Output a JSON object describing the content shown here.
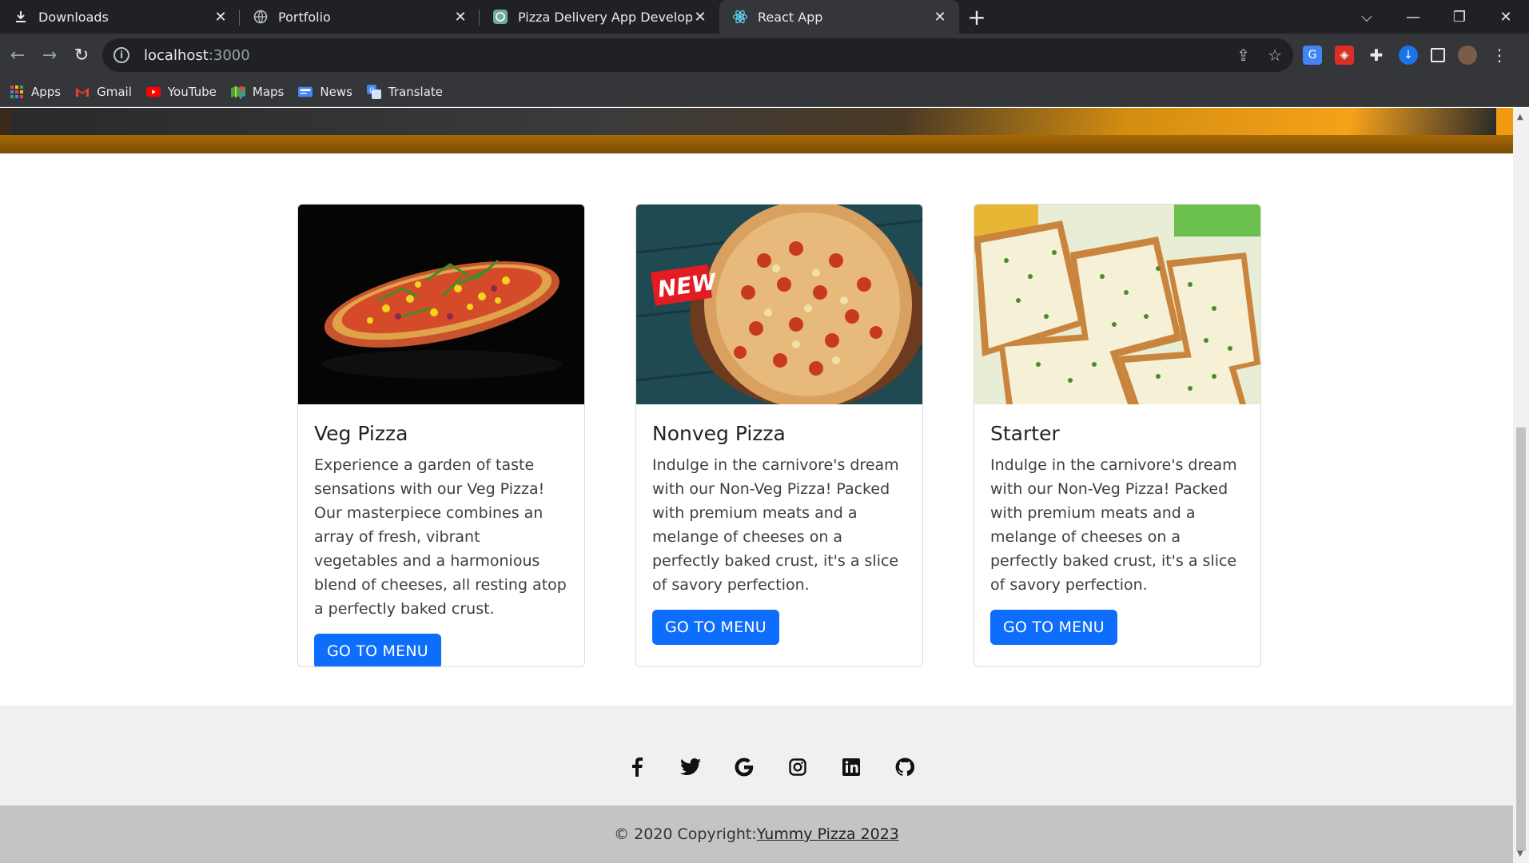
{
  "browser": {
    "tabs": [
      {
        "label": "Downloads",
        "icon": "download-icon"
      },
      {
        "label": "Portfolio",
        "icon": "globe-icon"
      },
      {
        "label": "Pizza Delivery App Development",
        "icon": "chatgpt-icon"
      },
      {
        "label": "React App",
        "icon": "react-icon",
        "active": true
      }
    ],
    "url_host": "localhost",
    "url_port": ":3000",
    "bookmarks": [
      {
        "label": "Apps",
        "icon": "apps-grid-icon"
      },
      {
        "label": "Gmail",
        "icon": "gmail-icon"
      },
      {
        "label": "YouTube",
        "icon": "youtube-icon"
      },
      {
        "label": "Maps",
        "icon": "maps-icon"
      },
      {
        "label": "News",
        "icon": "news-icon"
      },
      {
        "label": "Translate",
        "icon": "translate-icon"
      }
    ]
  },
  "cards": [
    {
      "title": "Veg Pizza",
      "text": "Experience a garden of taste sensations with our Veg Pizza! Our masterpiece combines an array of fresh, vibrant vegetables and a harmonious blend of cheeses, all resting atop a perfectly baked crust.",
      "button": "GO TO MENU"
    },
    {
      "title": "Nonveg Pizza",
      "text": "Indulge in the carnivore's dream with our Non-Veg Pizza! Packed with premium meats and a melange of cheeses on a perfectly baked crust, it's a slice of savory perfection.",
      "button": "GO TO MENU",
      "badge": "NEW"
    },
    {
      "title": "Starter",
      "text": "Indulge in the carnivore's dream with our Non-Veg Pizza! Packed with premium meats and a melange of cheeses on a perfectly baked crust, it's a slice of savory perfection.",
      "button": "GO TO MENU"
    }
  ],
  "footer": {
    "social_icons": [
      "facebook-icon",
      "twitter-icon",
      "google-icon",
      "instagram-icon",
      "linkedin-icon",
      "github-icon"
    ],
    "copyright_prefix": "© 2020 Copyright:",
    "copyright_link": "Yummy Pizza 2023"
  },
  "colors": {
    "primary_button": "#0d6efd",
    "tabbar": "#202124",
    "toolbar": "#35363a",
    "footer_light": "#f0f0f0",
    "footer_dark": "#c4c4c4"
  }
}
